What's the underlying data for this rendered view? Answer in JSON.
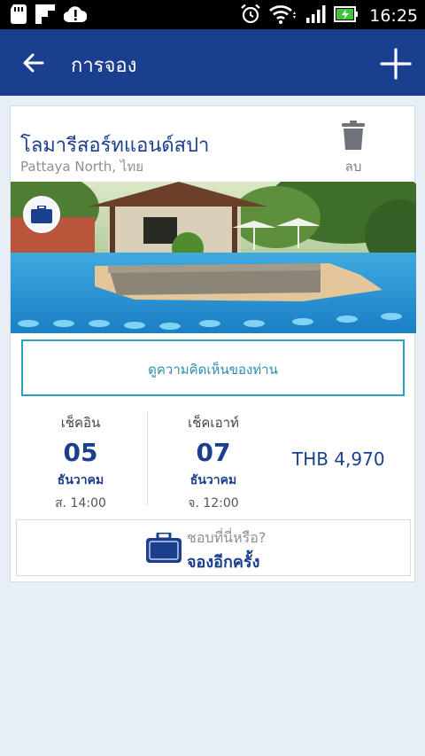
{
  "status_bar": {
    "time": "16:25",
    "icons": [
      "sd-card-icon",
      "flipboard-icon",
      "alert-cloud-icon",
      "alarm-icon",
      "wifi-icon",
      "signal-icon",
      "battery-charging-icon"
    ]
  },
  "app_bar": {
    "title": "การจอง",
    "back_icon": "back-arrow-icon",
    "add_icon": "plus-icon",
    "background": "#1b3f8f"
  },
  "booking": {
    "hotel_name": "โลมารีสอร์ทแอนด์สปา",
    "location": "Pattaya North, ไทย",
    "delete_label": "ลบ",
    "review_label": "ดูความคิดเห็นของท่าน",
    "checkin": {
      "label": "เช็คอิน",
      "day": "05",
      "month": "ธันวาคม",
      "time": "ส. 14:00"
    },
    "checkout": {
      "label": "เช็คเอาท์",
      "day": "07",
      "month": "ธันวาคม",
      "time": "จ. 12:00"
    },
    "price": "THB 4,970",
    "rebook": {
      "question": "ชอบที่นี่หรือ?",
      "action": "จองอีกครั้ง"
    }
  },
  "colors": {
    "accent": "#1b3f8f",
    "review_border": "#2b9fbf",
    "background": "#e8eef5"
  }
}
